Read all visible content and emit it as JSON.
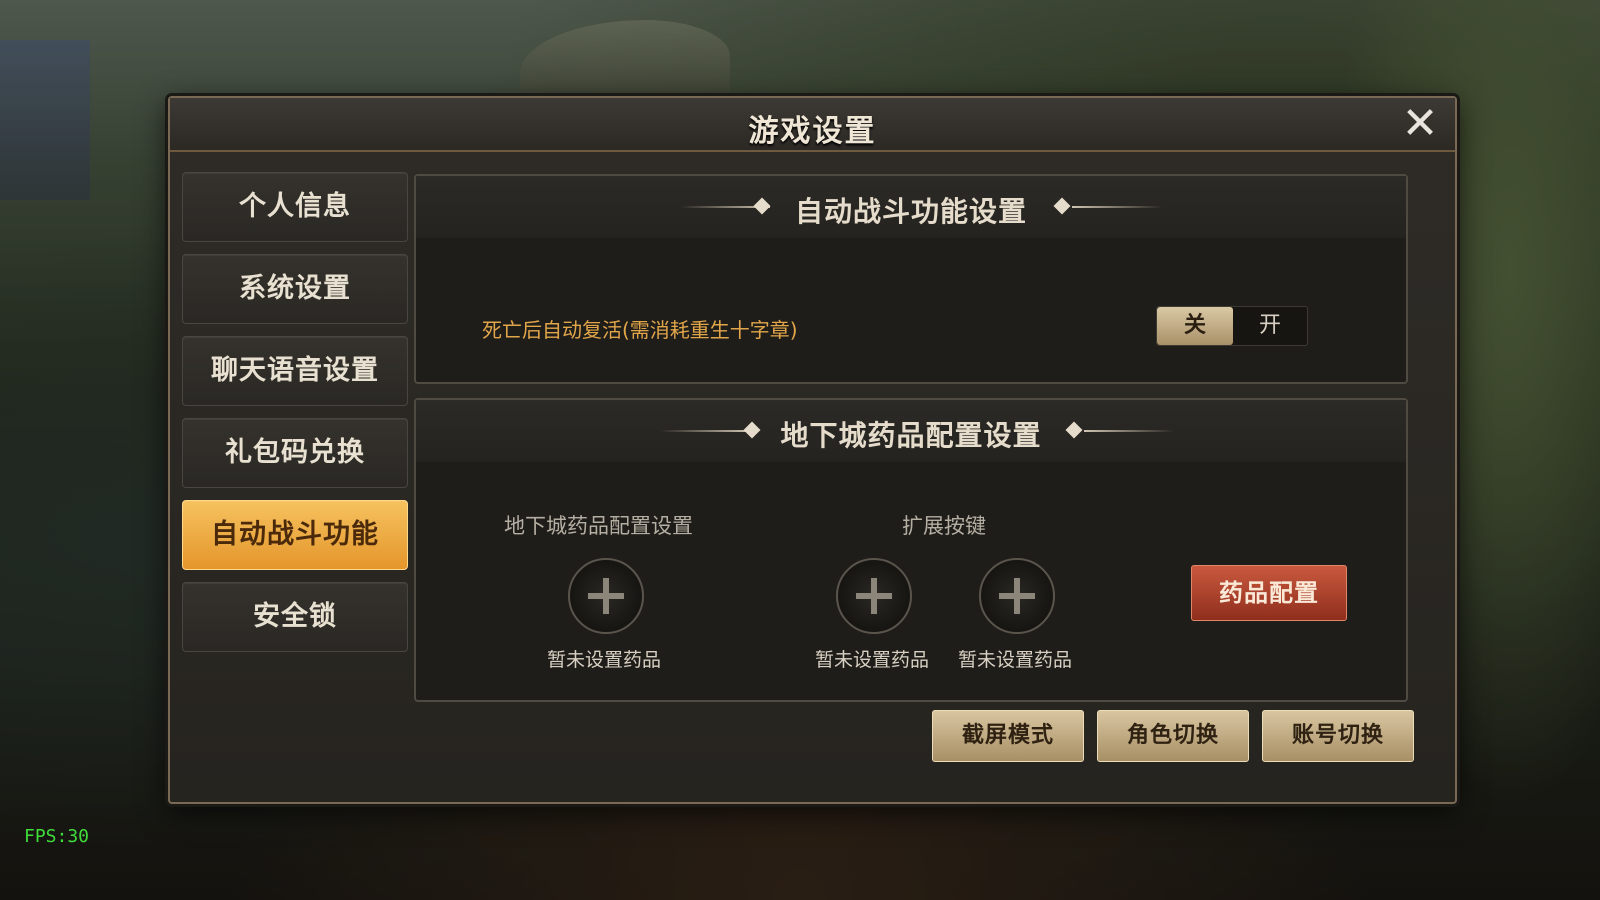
{
  "window": {
    "title": "游戏设置",
    "close_icon": "close-icon"
  },
  "sidebar": {
    "items": [
      {
        "label": "个人信息"
      },
      {
        "label": "系统设置"
      },
      {
        "label": "聊天语音设置"
      },
      {
        "label": "礼包码兑换"
      },
      {
        "label": "自动战斗功能",
        "active": true
      },
      {
        "label": "安全锁"
      }
    ]
  },
  "auto_battle": {
    "title": "自动战斗功能设置",
    "revive_label": "死亡后自动复活(需消耗重生十字章)",
    "toggle_off": "关",
    "toggle_on": "开",
    "toggle_state": "off"
  },
  "dungeon": {
    "title": "地下城药品配置设置",
    "col_potion": "地下城药品配置设置",
    "col_extend": "扩展按键",
    "slot_empty": "暂未设置药品",
    "med_button": "药品配置"
  },
  "bottom_buttons": {
    "screenshot": "截屏模式",
    "switch_role": "角色切换",
    "switch_account": "账号切换"
  },
  "hud": {
    "fps": "FPS:30"
  },
  "colors": {
    "active_tab": "#e4962b",
    "highlight_text": "#e2a64a",
    "med_button": "#a8392a",
    "fps": "#3fdc3a"
  }
}
